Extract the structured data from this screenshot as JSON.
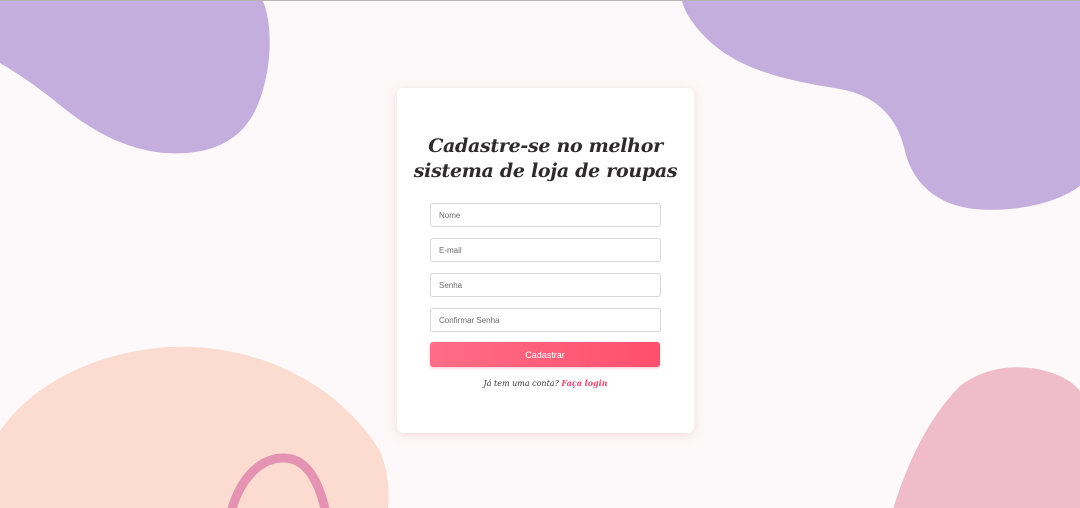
{
  "colors": {
    "background": "#fdf8f9",
    "blob_purple": "#c4aedd",
    "blob_peach": "#fcdcd1",
    "blob_pink": "#f0bcca",
    "swirl": "#e493b3",
    "button_start": "#ff6d86",
    "button_end": "#ff4f6e",
    "link": "#e8456a"
  },
  "form": {
    "title_line1": "Cadastre-se no melhor",
    "title_line2": "sistema de loja de roupas",
    "name_placeholder": "Nome",
    "email_placeholder": "E-mail",
    "password_placeholder": "Senha",
    "confirm_placeholder": "Confirmar Senha",
    "submit_label": "Cadastrar",
    "footer_text": "Já tem uma conta?",
    "login_link": "Faça login"
  }
}
